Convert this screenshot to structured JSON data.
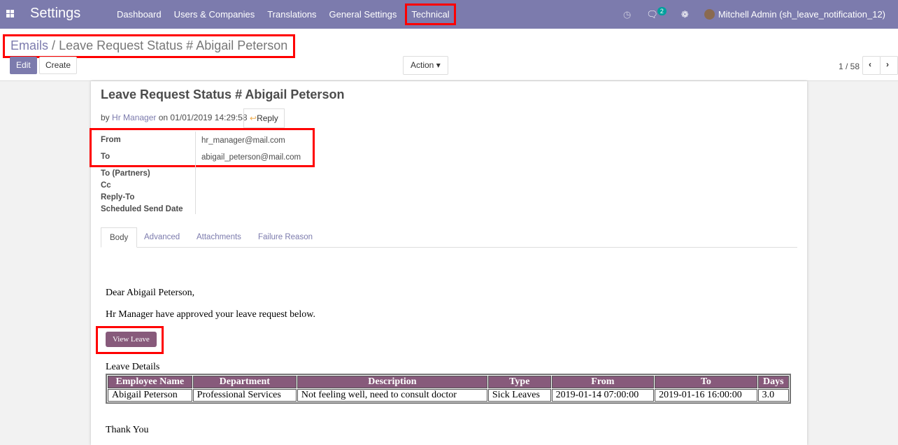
{
  "app": {
    "title": "Settings",
    "menu": [
      "Dashboard",
      "Users & Companies",
      "Translations",
      "General Settings",
      "Technical"
    ],
    "badge": "2",
    "user": "Mitchell Admin (sh_leave_notification_12)"
  },
  "breadcrumb": {
    "parent": "Emails",
    "sep": "/",
    "current": "Leave Request Status # Abigail Peterson"
  },
  "toolbar": {
    "edit": "Edit",
    "create": "Create",
    "action": "Action",
    "pager": "1 / 58"
  },
  "mail": {
    "title": "Leave Request Status # Abigail Peterson",
    "by": "by",
    "author": "Hr Manager",
    "on": "on 01/01/2019 14:29:58",
    "reply": "Reply",
    "fields": [
      {
        "label": "From",
        "value": "hr_manager@mail.com"
      },
      {
        "label": "To",
        "value": "abigail_peterson@mail.com"
      },
      {
        "label": "To (Partners)",
        "value": ""
      },
      {
        "label": "Cc",
        "value": ""
      },
      {
        "label": "Reply-To",
        "value": ""
      },
      {
        "label": "Scheduled Send Date",
        "value": ""
      }
    ],
    "tabs": [
      "Body",
      "Advanced",
      "Attachments",
      "Failure Reason"
    ]
  },
  "body": {
    "greeting": "Dear Abigail Peterson,",
    "message": "Hr Manager have approved your leave request below.",
    "button": "View Leave",
    "details_title": "Leave Details",
    "headers": [
      "Employee Name",
      "Department",
      "Description",
      "Type",
      "From",
      "To",
      "Days"
    ],
    "row": [
      "Abigail Peterson",
      "Professional Services",
      "Not feeling well, need to consult doctor",
      "Sick Leaves",
      "2019-01-14 07:00:00",
      "2019-01-16 16:00:00",
      "3.0"
    ],
    "closing": "Thank You"
  },
  "colors": {
    "navbar": "#7c7bad",
    "accent": "#875a7b",
    "highlight": "#ff0000"
  }
}
